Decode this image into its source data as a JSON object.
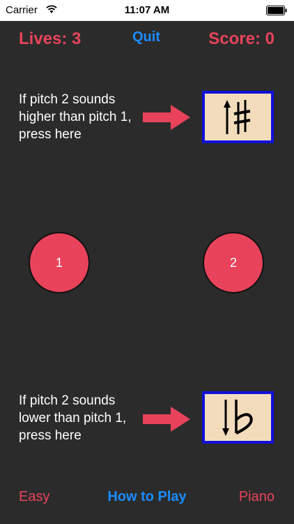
{
  "status_bar": {
    "carrier": "Carrier",
    "time": "11:07 AM"
  },
  "header": {
    "lives": "Lives: 3",
    "quit": "Quit",
    "score": "Score: 0"
  },
  "instructions": {
    "higher": "If pitch 2 sounds higher than pitch 1, press here",
    "lower": "If pitch 2 sounds lower than pitch 1, press here"
  },
  "pitches": {
    "pitch1": "1",
    "pitch2": "2"
  },
  "footer": {
    "easy": "Easy",
    "how_to_play": "How to Play",
    "piano": "Piano"
  },
  "colors": {
    "background": "#2b2b2b",
    "accent_red": "#e8435b",
    "accent_blue": "#1a8cff",
    "button_face": "#f3dcbc",
    "button_border": "#1010d8"
  },
  "icons": {
    "sharp_button": "up-arrow-sharp-icon",
    "flat_button": "down-arrow-flat-icon"
  }
}
